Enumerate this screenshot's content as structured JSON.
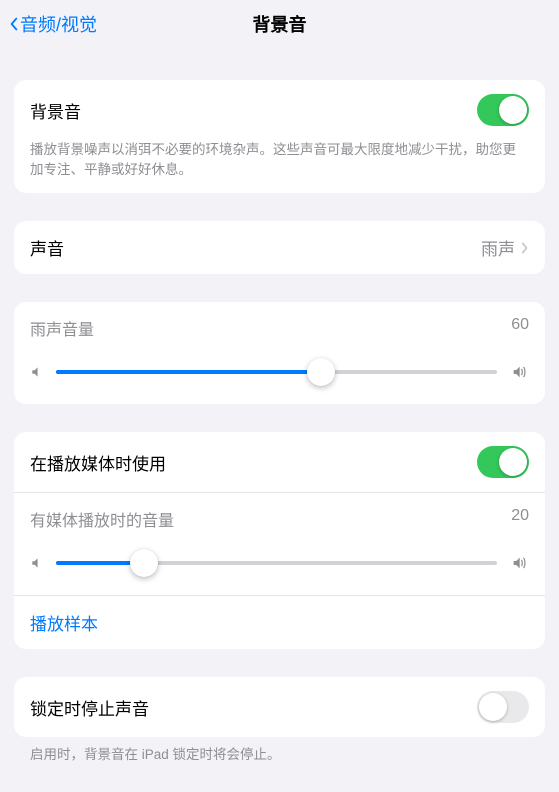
{
  "nav": {
    "back_label": "音频/视觉",
    "title": "背景音"
  },
  "bg": {
    "label": "背景音",
    "enabled": true,
    "desc": "播放背景噪声以消弭不必要的环境杂声。这些声音可最大限度地减少干扰，助您更加专注、平静或好好休息。"
  },
  "sound": {
    "label": "声音",
    "value": "雨声"
  },
  "vol": {
    "label": "雨声音量",
    "value": "60",
    "percent": 60
  },
  "media": {
    "label": "在播放媒体时使用",
    "enabled": true,
    "vol_label": "有媒体播放时的音量",
    "vol_value": "20",
    "vol_percent": 20,
    "sample_label": "播放样本"
  },
  "lock": {
    "label": "锁定时停止声音",
    "enabled": false,
    "desc": "启用时，背景音在 iPad 锁定时将会停止。"
  }
}
